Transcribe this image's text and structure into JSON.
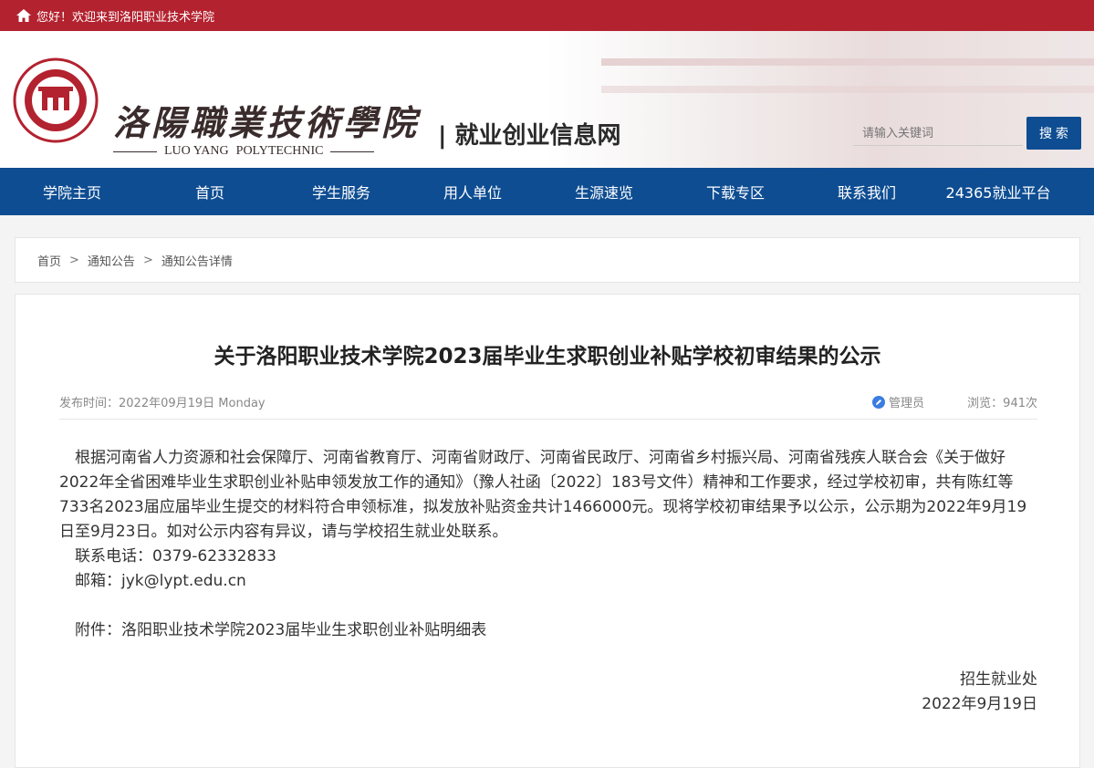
{
  "topbar": {
    "welcome": "您好！欢迎来到洛阳职业技术学院"
  },
  "header": {
    "school_cn": "洛陽職業技術學院",
    "school_en_1": "LUO YANG",
    "school_en_2": "POLYTECHNIC",
    "site_title": "| 就业创业信息网",
    "search_placeholder": "请输入关键词",
    "search_button": "搜 索"
  },
  "nav": [
    {
      "label": "学院主页"
    },
    {
      "label": "首页"
    },
    {
      "label": "学生服务"
    },
    {
      "label": "用人单位"
    },
    {
      "label": "生源速览"
    },
    {
      "label": "下载专区"
    },
    {
      "label": "联系我们"
    },
    {
      "label": "24365就业平台"
    }
  ],
  "breadcrumb": {
    "home": "首页",
    "sep": ">",
    "section": "通知公告",
    "current": "通知公告详情"
  },
  "article": {
    "title": "关于洛阳职业技术学院2023届毕业生求职创业补贴学校初审结果的公示",
    "publish": "发布时间：2022年09月19日 Monday",
    "author": "管理员",
    "views": "浏览：941次",
    "para1": "根据河南省人力资源和社会保障厅、河南省教育厅、河南省财政厅、河南省民政厅、河南省乡村振兴局、河南省残疾人联合会《关于做好2022年全省困难毕业生求职创业补贴申领发放工作的通知》（豫人社函〔2022〕183号文件）精神和工作要求，经过学校初审，共有陈红等733名2023届应届毕业生提交的材料符合申领标准，拟发放补贴资金共计1466000元。现将学校初审结果予以公示，公示期为2022年9月19日至9月23日。如对公示内容有异议，请与学校招生就业处联系。",
    "phone": "联系电话：0379-62332833",
    "email": "邮箱：jyk@lypt.edu.cn",
    "attachment": "附件：洛阳职业技术学院2023届毕业生求职创业补贴明细表",
    "signer": "招生就业处",
    "sign_date": "2022年9月19日"
  },
  "colors": {
    "topbar": "#b3222f",
    "nav": "#0e4d92",
    "search_button": "#0e4d92"
  }
}
